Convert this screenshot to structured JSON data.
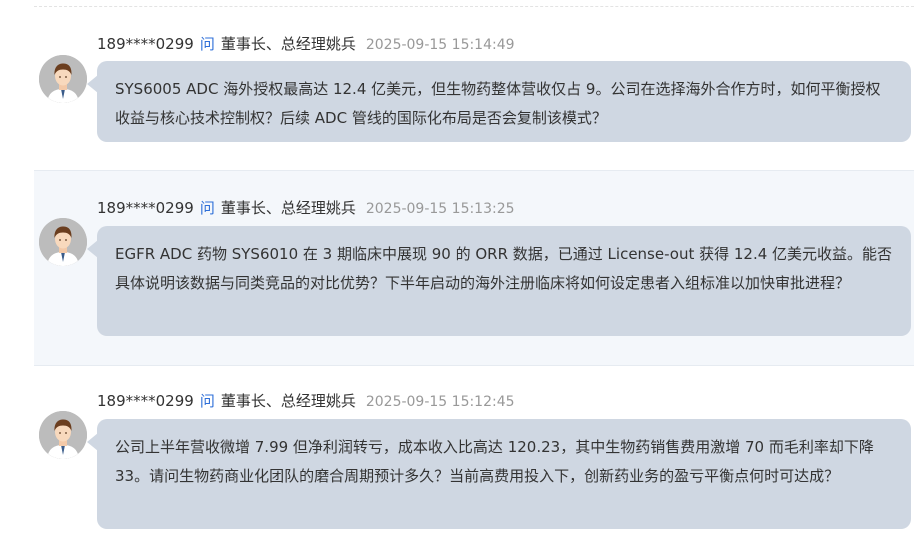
{
  "questions": [
    {
      "user": "189****0299",
      "verb": "问",
      "target": "董事长、总经理姚兵",
      "time": "2025-09-15 15:14:49",
      "text": "SYS6005 ADC 海外授权最高达 12.4 亿美元，但生物药整体营收仅占 9。公司在选择海外合作方时，如何平衡授权收益与核心技术控制权？后续 ADC 管线的国际化布局是否会复制该模式？"
    },
    {
      "user": "189****0299",
      "verb": "问",
      "target": "董事长、总经理姚兵",
      "time": "2025-09-15 15:13:25",
      "text": "EGFR ADC 药物 SYS6010 在 3 期临床中展现 90 的 ORR 数据，已通过 License-out 获得 12.4 亿美元收益。能否具体说明该数据与同类竞品的对比优势？下半年启动的海外注册临床将如何设定患者入组标准以加快审批进程？"
    },
    {
      "user": "189****0299",
      "verb": "问",
      "target": "董事长、总经理姚兵",
      "time": "2025-09-15 15:12:45",
      "text": "公司上半年营收微增 7.99 但净利润转亏，成本收入比高达 120.23，其中生物药销售费用激增 70 而毛利率却下降 33。请问生物药商业化团队的磨合周期预计多久？当前高费用投入下，创新药业务的盈亏平衡点何时可达成？"
    }
  ],
  "colors": {
    "bubble": "#cfd7e2",
    "verb": "#2e6fd8",
    "highlight_bg": "#f4f7fb"
  },
  "icons": {
    "avatar": "user-avatar-icon"
  }
}
